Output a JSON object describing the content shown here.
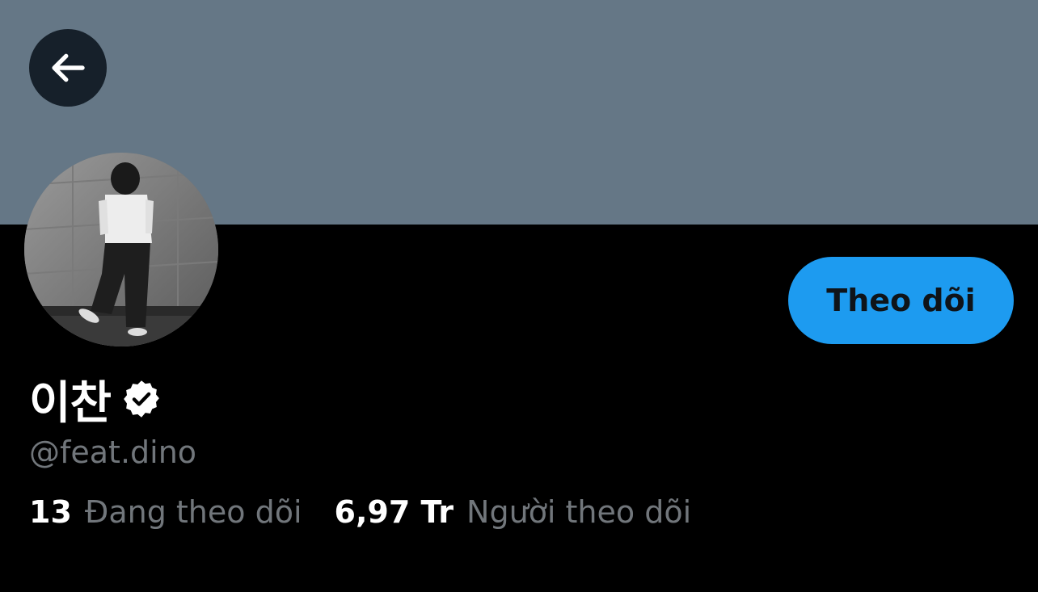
{
  "banner": {
    "color": "#657786"
  },
  "header": {
    "back_icon": "arrow-left-icon"
  },
  "profile": {
    "display_name": "이찬",
    "verified_icon": "verified-badge-icon",
    "handle": "@feat.dino",
    "follow_button_label": "Theo dõi",
    "accent_color": "#1d9bf0"
  },
  "stats": {
    "following_count": "13",
    "following_label": "Đang theo dõi",
    "followers_count": "6,97 Tr",
    "followers_label": "Người theo dõi"
  }
}
